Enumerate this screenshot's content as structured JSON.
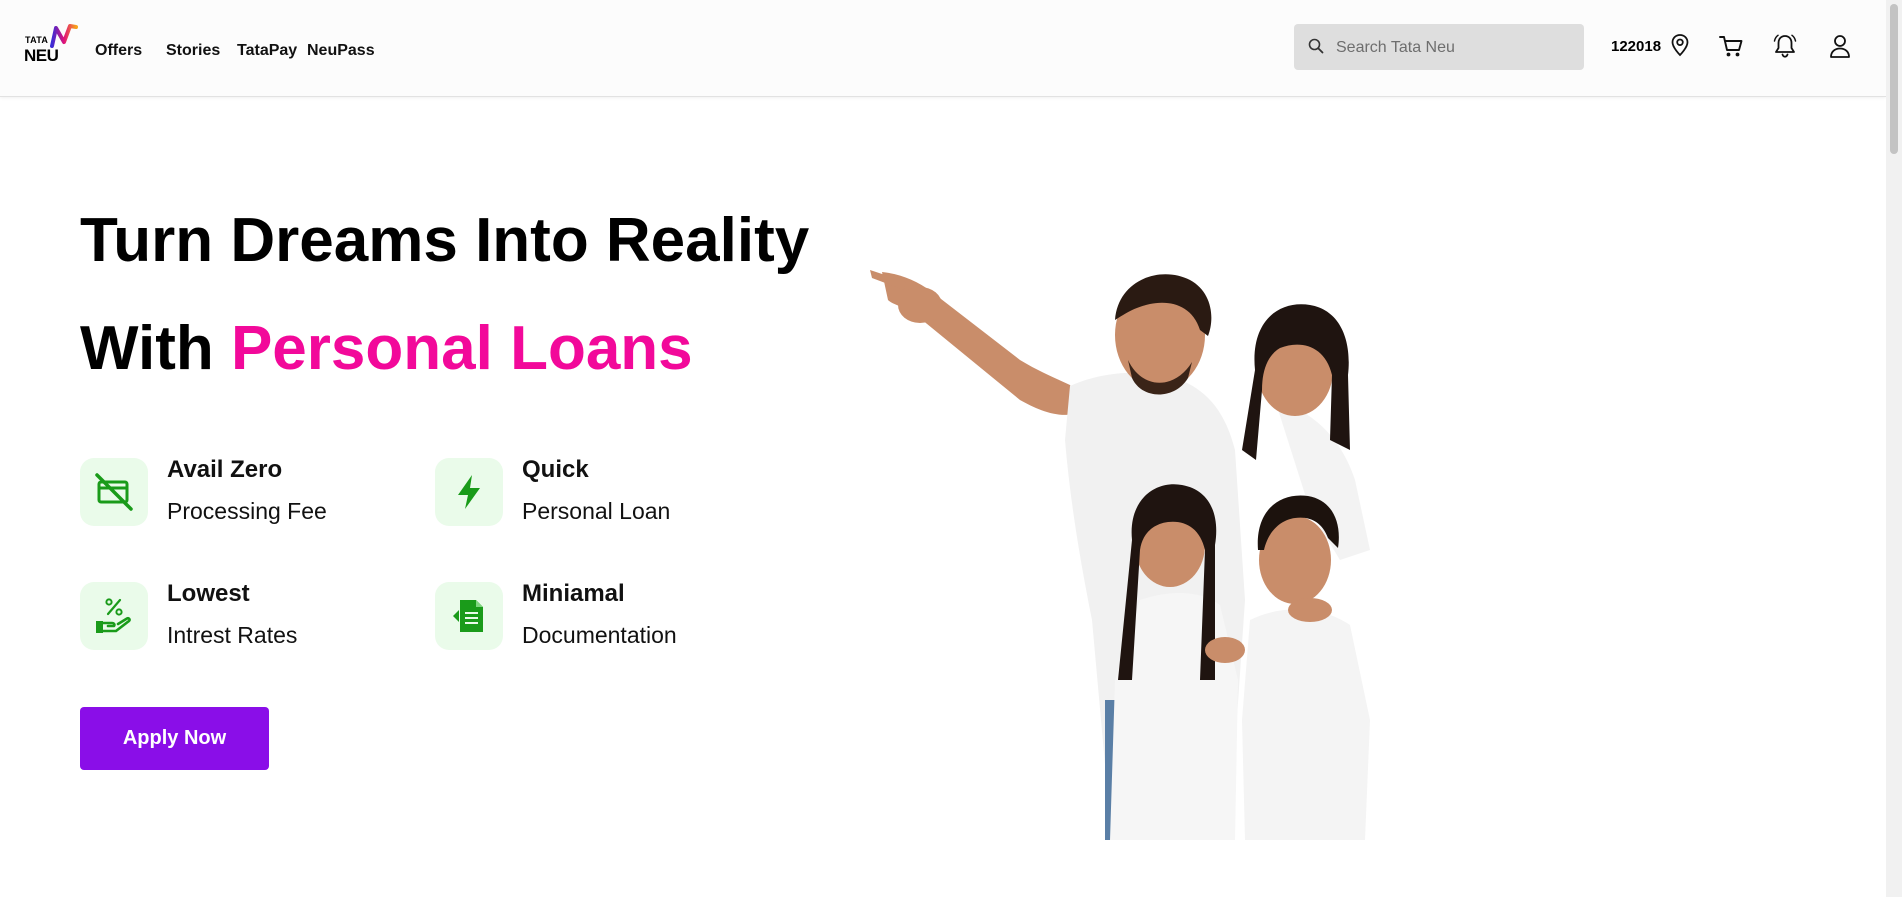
{
  "header": {
    "logo_top": "TATA",
    "logo_bottom": "NEU",
    "nav": [
      "Offers",
      "Stories",
      "TataPay",
      "NeuPass"
    ],
    "search_placeholder": "Search Tata Neu",
    "pincode": "122018",
    "icons": [
      "search-icon",
      "location-pin-icon",
      "cart-icon",
      "bell-icon",
      "user-icon"
    ]
  },
  "hero": {
    "headline_line1": "Turn Dreams Into Reality",
    "headline_line2_prefix": "With",
    "headline_line2_accent": "Personal Loans",
    "features": [
      {
        "title": "Avail Zero",
        "subtitle": "Processing Fee",
        "icon": "no-card-icon"
      },
      {
        "title": "Quick",
        "subtitle": "Personal Loan",
        "icon": "lightning-icon"
      },
      {
        "title": "Lowest",
        "subtitle": "Intrest Rates",
        "icon": "percent-hand-icon"
      },
      {
        "title": "Miniamal",
        "subtitle": "Documentation",
        "icon": "document-icon"
      }
    ],
    "cta_label": "Apply Now",
    "image": "family-pointing-photo"
  },
  "colors": {
    "accent_pink": "#f2099a",
    "cta_purple": "#8a0ee8",
    "icon_green": "#1a9b1a",
    "icon_bg": "#eafbea"
  }
}
